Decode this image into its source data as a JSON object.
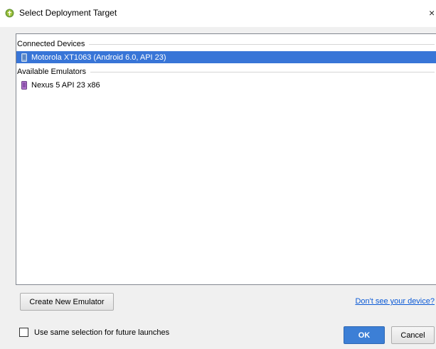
{
  "window": {
    "title": "Select Deployment Target",
    "close_glyph": "×",
    "app_icon": "android-studio-icon"
  },
  "device_list": {
    "groups": [
      {
        "header": "Connected Devices",
        "devices": [
          {
            "label": "Motorola XT1063 (Android 6.0, API 23)",
            "selected": true,
            "icon": "phone-device-icon"
          }
        ]
      },
      {
        "header": "Available Emulators",
        "devices": [
          {
            "label": "Nexus 5 API 23 x86",
            "selected": false,
            "icon": "emulator-device-icon"
          }
        ]
      }
    ]
  },
  "actions": {
    "create_emulator_label": "Create New Emulator",
    "help_link_label": "Don't see your device?",
    "remember_checkbox_label": "Use same selection for future launches",
    "remember_checked": false,
    "ok_label": "OK",
    "cancel_label": "Cancel"
  },
  "colors": {
    "selection": "#3875d7",
    "primary_button": "#3c7fd6",
    "link": "#0b5ad6"
  }
}
